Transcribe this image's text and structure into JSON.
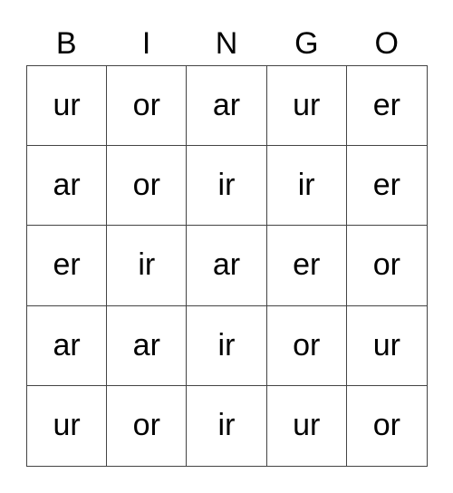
{
  "header": [
    "B",
    "I",
    "N",
    "G",
    "O"
  ],
  "rows": [
    [
      "ur",
      "or",
      "ar",
      "ur",
      "er"
    ],
    [
      "ar",
      "or",
      "ir",
      "ir",
      "er"
    ],
    [
      "er",
      "ir",
      "ar",
      "er",
      "or"
    ],
    [
      "ar",
      "ar",
      "ir",
      "or",
      "ur"
    ],
    [
      "ur",
      "or",
      "ir",
      "ur",
      "or"
    ]
  ]
}
